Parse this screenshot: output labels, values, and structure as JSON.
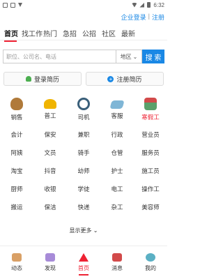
{
  "status": {
    "time": "6:32"
  },
  "top_links": {
    "company_login": "企业登录",
    "register": "注册"
  },
  "tabs": [
    {
      "label": "首页"
    },
    {
      "label": "找工作"
    },
    {
      "label": "热门"
    },
    {
      "label": "急招"
    },
    {
      "label": "公招"
    },
    {
      "label": "社区"
    },
    {
      "label": "最新"
    }
  ],
  "search": {
    "placeholder": "职位、公司名、电话",
    "area": "地区",
    "button": "搜 索"
  },
  "resume": {
    "login": "登录简历",
    "register": "注册简历"
  },
  "icon_categories": [
    {
      "label": "销售",
      "icon": "money-bag-icon",
      "color": "#b07a3a"
    },
    {
      "label": "普工",
      "icon": "hard-hat-icon",
      "color": "#f0b400"
    },
    {
      "label": "司机",
      "icon": "steering-wheel-icon",
      "color": "#3a5f7a"
    },
    {
      "label": "客服",
      "icon": "keyboard-icon",
      "color": "#7fb6d6"
    },
    {
      "label": "寒假工",
      "icon": "gift-box-icon",
      "color": "#5aa06a",
      "highlight": true
    }
  ],
  "category_rows": [
    [
      "会计",
      "保安",
      "兼职",
      "行政",
      "营业员"
    ],
    [
      "阿姨",
      "文员",
      "骑手",
      "仓管",
      "服务员"
    ],
    [
      "淘宝",
      "抖音",
      "幼师",
      "护士",
      "施工员"
    ],
    [
      "厨师",
      "收银",
      "学徒",
      "电工",
      "操作工"
    ],
    [
      "搬运",
      "保洁",
      "快递",
      "杂工",
      "美容师"
    ]
  ],
  "show_more": "显示更多",
  "bottom_nav": [
    {
      "label": "动态",
      "icon": "news-icon",
      "color": "#d9a066"
    },
    {
      "label": "发现",
      "icon": "discover-icon",
      "color": "#a78bd8"
    },
    {
      "label": "首页",
      "icon": "home-icon",
      "color": "#e23",
      "active": true
    },
    {
      "label": "消息",
      "icon": "message-icon",
      "color": "#d24a4a"
    },
    {
      "label": "我的",
      "icon": "profile-icon",
      "color": "#5bb0c4"
    }
  ]
}
